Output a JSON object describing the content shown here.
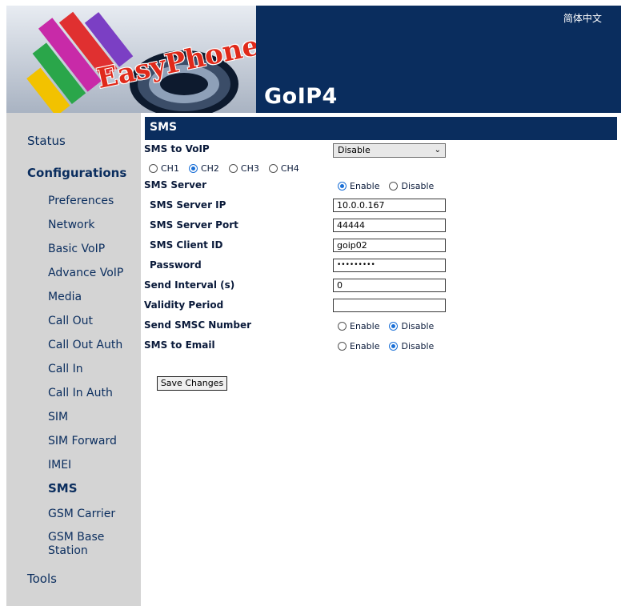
{
  "header": {
    "brand": "EasyPhone",
    "product": "GoIP4",
    "language_link": "简体中文",
    "colors": {
      "navy": "#0a2d5e",
      "sidebar": "#d4d4d4"
    }
  },
  "sidebar": {
    "status": "Status",
    "configurations": "Configurations",
    "items": [
      {
        "label": "Preferences"
      },
      {
        "label": "Network"
      },
      {
        "label": "Basic VoIP"
      },
      {
        "label": "Advance VoIP"
      },
      {
        "label": "Media"
      },
      {
        "label": "Call Out"
      },
      {
        "label": "Call Out Auth"
      },
      {
        "label": "Call In"
      },
      {
        "label": "Call In Auth"
      },
      {
        "label": "SIM"
      },
      {
        "label": "SIM Forward"
      },
      {
        "label": "IMEI"
      },
      {
        "label": "SMS",
        "active": true
      },
      {
        "label": "GSM Carrier"
      },
      {
        "label": "GSM Base",
        "label2": "Station"
      }
    ],
    "tools": "Tools"
  },
  "section": {
    "title": "SMS"
  },
  "form": {
    "sms_to_voip": {
      "label": "SMS to VoIP",
      "value": "Disable"
    },
    "channels": {
      "options": [
        "CH1",
        "CH2",
        "CH3",
        "CH4"
      ],
      "selected": "CH2"
    },
    "sms_server": {
      "label": "SMS Server",
      "enable": "Enable",
      "disable": "Disable",
      "selected": "Enable"
    },
    "server_ip": {
      "label": "SMS Server IP",
      "value": "10.0.0.167"
    },
    "server_port": {
      "label": "SMS Server Port",
      "value": "44444"
    },
    "client_id": {
      "label": "SMS Client ID",
      "value": "goip02"
    },
    "password": {
      "label": "Password",
      "value": "•••••••••"
    },
    "send_interval": {
      "label": "Send Interval (s)",
      "value": "0"
    },
    "validity_period": {
      "label": "Validity Period",
      "value": ""
    },
    "send_smsc": {
      "label": "Send SMSC Number",
      "enable": "Enable",
      "disable": "Disable",
      "selected": "Disable"
    },
    "sms_to_email": {
      "label": "SMS to Email",
      "enable": "Enable",
      "disable": "Disable",
      "selected": "Disable"
    },
    "save_label": "Save Changes"
  }
}
